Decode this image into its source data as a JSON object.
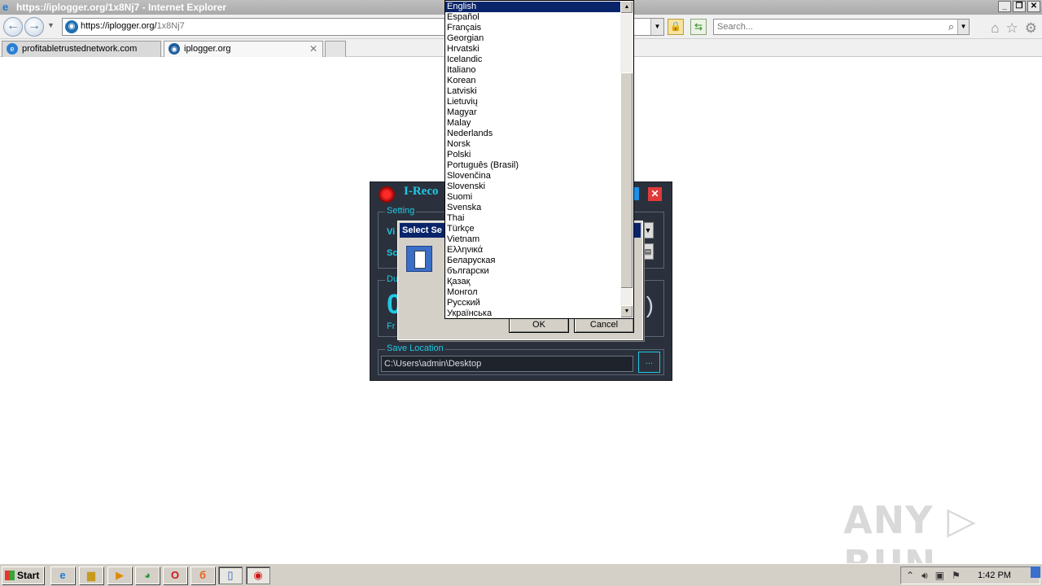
{
  "browser": {
    "title": "https://iplogger.org/1x8Nj7 - Internet Explorer",
    "window_controls": [
      "_",
      "❐",
      "✕"
    ],
    "address": {
      "host": "https://iplogger.org/",
      "path": "1x8Nj7"
    },
    "search_placeholder": "Search...",
    "tabs": [
      {
        "label": "profitabletrustednetwork.com"
      },
      {
        "label": "iplogger.org",
        "close": "✕"
      }
    ]
  },
  "app": {
    "title": "I-Reco",
    "setting_legend": "Setting",
    "row1_label": "Vi",
    "row2_label": "Sc",
    "duration_legend": "Du",
    "duration_digit": "0",
    "duration_right": ")",
    "frame_label": "Fr",
    "save_legend": "Save Location",
    "save_path": "C:\\Users\\admin\\Desktop",
    "browse_label": "..."
  },
  "dialog": {
    "title": "Select Se",
    "ok_label": "OK",
    "cancel_label": "Cancel"
  },
  "languages": {
    "selected_index": 0,
    "items": [
      "English",
      "Español",
      "Français",
      "Georgian",
      "Hrvatski",
      "Icelandic",
      "Italiano",
      "Korean",
      "Latviski",
      "Lietuvių",
      "Magyar",
      "Malay",
      "Nederlands",
      "Norsk",
      "Polski",
      "Português (Brasil)",
      "Slovenčina",
      "Slovenski",
      "Suomi",
      "Svenska",
      "Thai",
      "Türkçe",
      "Vietnam",
      "Ελληνικά",
      "Беларуская",
      "български",
      "Қазақ",
      "Монгол",
      "Русский",
      "Українська"
    ]
  },
  "watermark": "ANY ▷ RUN",
  "taskbar": {
    "start_label": "Start",
    "clock": "1:42 PM"
  }
}
